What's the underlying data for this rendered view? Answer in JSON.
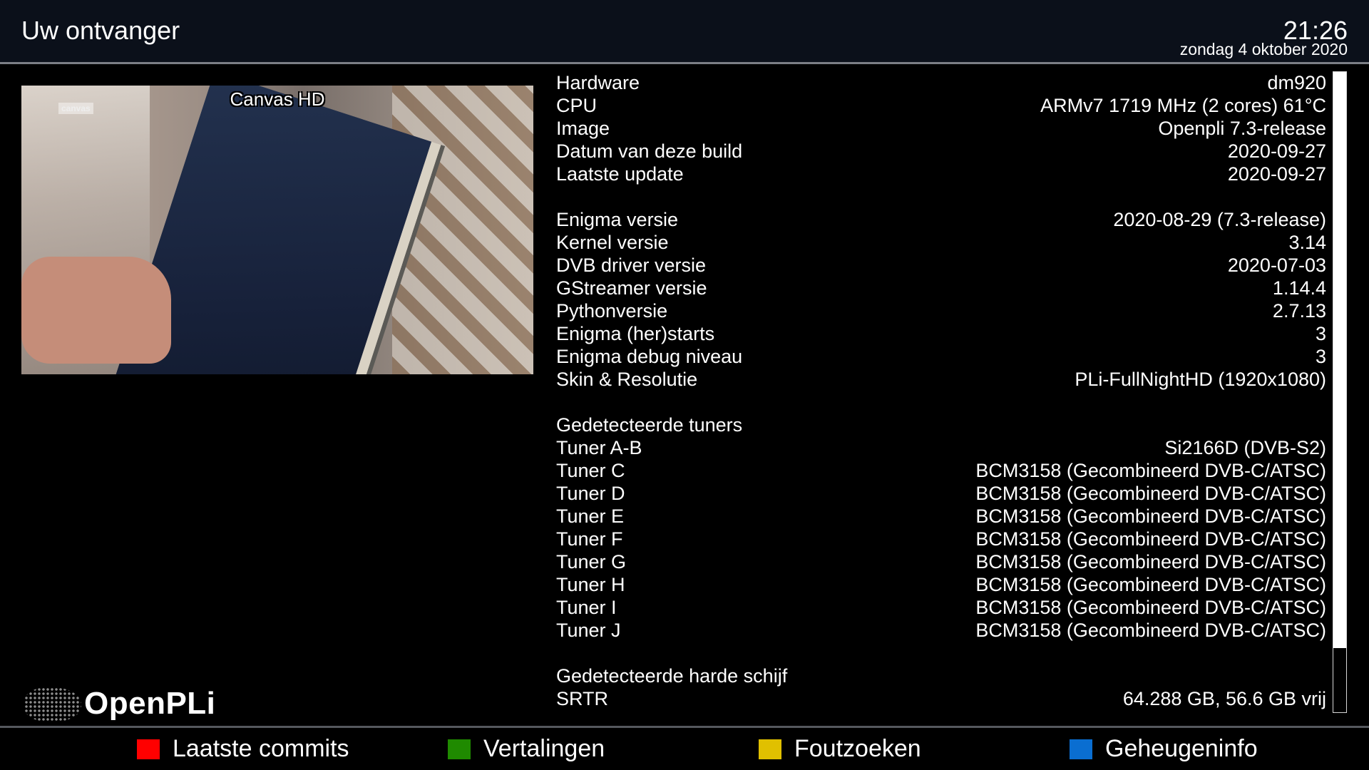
{
  "header": {
    "title": "Uw ontvanger",
    "time": "21:26",
    "date": "zondag  4 oktober 2020"
  },
  "video": {
    "channel": "Canvas HD",
    "watermark": "canvas"
  },
  "brand": {
    "logo_text": "OpenPLi"
  },
  "info_rows": [
    {
      "label": "Hardware",
      "value": "dm920"
    },
    {
      "label": "CPU",
      "value": "ARMv7 1719 MHz (2 cores) 61°C"
    },
    {
      "label": "Image",
      "value": "Openpli 7.3-release"
    },
    {
      "label": "Datum van deze build",
      "value": "2020-09-27"
    },
    {
      "label": "Laatste update",
      "value": "2020-09-27"
    },
    {
      "label": "Enigma versie",
      "value": "2020-08-29 (7.3-release)"
    },
    {
      "label": "Kernel versie",
      "value": "3.14"
    },
    {
      "label": "DVB driver versie",
      "value": "2020-07-03"
    },
    {
      "label": "GStreamer versie",
      "value": "1.14.4"
    },
    {
      "label": "Pythonversie",
      "value": "2.7.13"
    },
    {
      "label": "Enigma (her)starts",
      "value": "3"
    },
    {
      "label": "Enigma debug niveau",
      "value": "3"
    },
    {
      "label": "Skin & Resolutie",
      "value": "PLi-FullNightHD (1920x1080)"
    },
    {
      "label": "Gedetecteerde tuners",
      "value": ""
    },
    {
      "label": "Tuner A-B",
      "value": "Si2166D (DVB-S2)"
    },
    {
      "label": "Tuner C",
      "value": "BCM3158 (Gecombineerd DVB-C/ATSC)"
    },
    {
      "label": "Tuner D",
      "value": "BCM3158 (Gecombineerd DVB-C/ATSC)"
    },
    {
      "label": "Tuner E",
      "value": "BCM3158 (Gecombineerd DVB-C/ATSC)"
    },
    {
      "label": "Tuner F",
      "value": "BCM3158 (Gecombineerd DVB-C/ATSC)"
    },
    {
      "label": "Tuner G",
      "value": "BCM3158 (Gecombineerd DVB-C/ATSC)"
    },
    {
      "label": "Tuner H",
      "value": "BCM3158 (Gecombineerd DVB-C/ATSC)"
    },
    {
      "label": "Tuner I",
      "value": "BCM3158 (Gecombineerd DVB-C/ATSC)"
    },
    {
      "label": "Tuner J",
      "value": "BCM3158 (Gecombineerd DVB-C/ATSC)"
    },
    {
      "label": "Gedetecteerde harde schijf",
      "value": ""
    },
    {
      "label": "SRTR",
      "value": "64.288 GB, 56.6 GB vrij"
    }
  ],
  "scroll": {
    "visible_fraction": 0.9
  },
  "footer": {
    "red": {
      "label": "Laatste commits",
      "color": "#ff0000"
    },
    "green": {
      "label": "Vertalingen",
      "color": "#1f8a00"
    },
    "yellow": {
      "label": "Foutzoeken",
      "color": "#e0c000"
    },
    "blue": {
      "label": "Geheugeninfo",
      "color": "#0a6ed1"
    }
  }
}
